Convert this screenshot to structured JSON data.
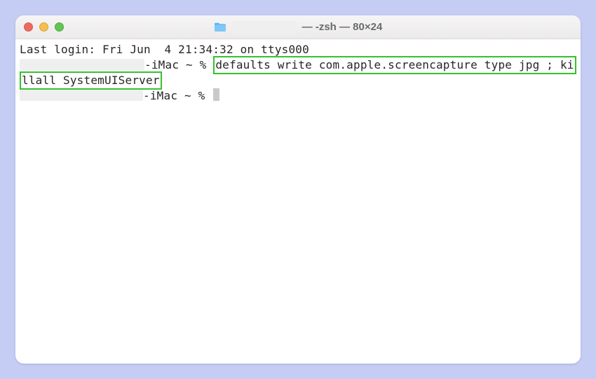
{
  "titlebar": {
    "title_suffix": "— -zsh — 80×24"
  },
  "terminal": {
    "last_login": "Last login: Fri Jun  4 21:34:32 on ttys000",
    "prompt1_host": "-iMac ~ % ",
    "cmd_part1": "defaults write com.apple.screencapture type jpg ; ki",
    "cmd_part2": "llall SystemUIServer",
    "prompt2_host": "-iMac ~ % "
  }
}
